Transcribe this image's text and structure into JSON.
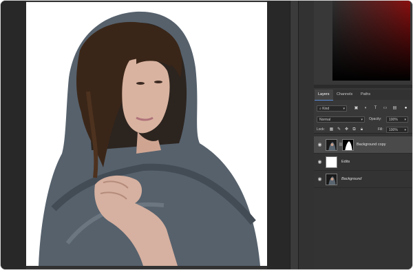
{
  "layers_panel": {
    "tabs": [
      "Layers",
      "Channels",
      "Paths"
    ],
    "filter_kind": "Kind",
    "blend_mode": "Normal",
    "opacity_label": "Opacity:",
    "opacity_value": "100%",
    "lock_label": "Lock:",
    "fill_label": "Fill:",
    "fill_value": "100%",
    "layers": [
      {
        "name": "Background copy",
        "selected": true,
        "visible": true,
        "thumbnail": "portrait",
        "has_mask": true
      },
      {
        "name": "Edits",
        "selected": false,
        "visible": true,
        "thumbnail": "white",
        "has_mask": false
      },
      {
        "name": "Background",
        "selected": false,
        "visible": true,
        "thumbnail": "portrait",
        "italic": true
      }
    ]
  },
  "colors": {
    "canvas_bg": "#ffffff",
    "panel_bg": "#383838",
    "gutter_bg": "#282828",
    "selected_row": "#4a4a4a"
  },
  "icons": {
    "eye": "eye-icon",
    "search": "search-icon",
    "chain": "link-icon"
  }
}
